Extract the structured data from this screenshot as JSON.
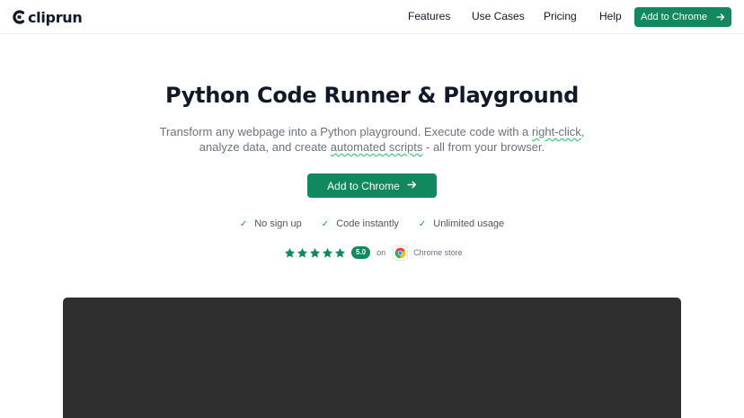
{
  "brand": {
    "name": "cliprun",
    "logo_icon": "c-logo-icon"
  },
  "nav": {
    "links": [
      "Features",
      "Use Cases",
      "Pricing",
      "Help"
    ],
    "cta_label": "Add to Chrome",
    "cta_icon": "arrow-right-icon"
  },
  "hero": {
    "title": "Python Code Runner & Playground",
    "subtitle": {
      "line1_a": "Transform any webpage into a Python playground. Execute code with a ",
      "line1_b": "right-click",
      "line1_c": ",",
      "line2_a": "analyze data, and create ",
      "line2_b": "automated scripts",
      "line2_c": " - all from your browser."
    },
    "cta_label": "Add to Chrome"
  },
  "features": [
    "No sign up",
    "Code instantly",
    "Unlimited usage"
  ],
  "rating": {
    "stars": 5,
    "score": "5.0",
    "on_text": "on",
    "store_label": "Chrome store"
  },
  "colors": {
    "accent": "#12885e",
    "check": "#16a34a",
    "demo_bg": "#2f2f2f"
  }
}
